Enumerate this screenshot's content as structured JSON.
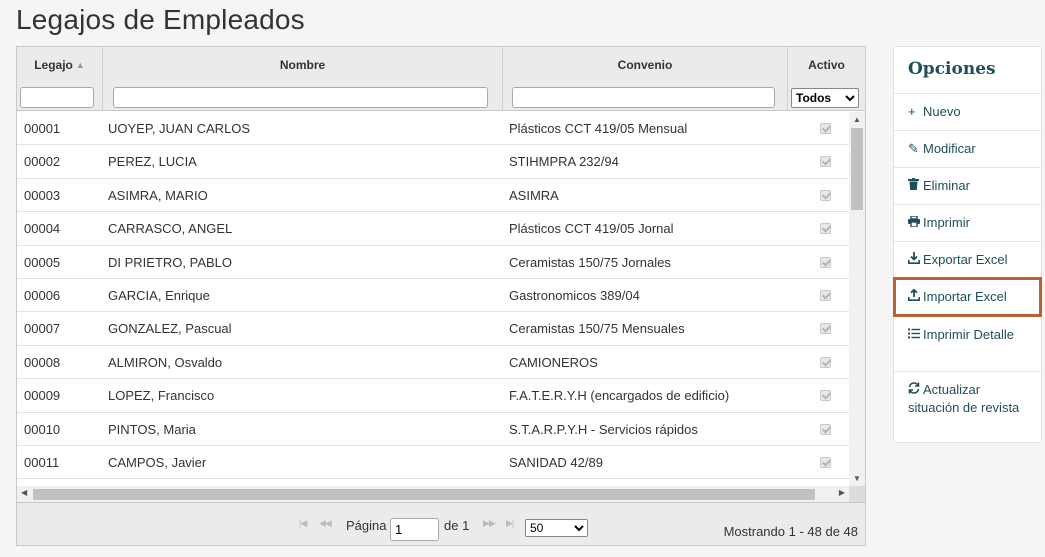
{
  "page": {
    "title": "Legajos de Empleados"
  },
  "grid": {
    "columns": [
      {
        "key": "legajo",
        "label": "Legajo"
      },
      {
        "key": "nombre",
        "label": "Nombre"
      },
      {
        "key": "convenio",
        "label": "Convenio"
      },
      {
        "key": "activo",
        "label": "Activo"
      }
    ],
    "activo_filter": {
      "selected": "Todos",
      "options": [
        "Todos"
      ]
    },
    "rows": [
      {
        "legajo": "00001",
        "nombre": "UOYEP, JUAN CARLOS",
        "convenio": "Plásticos CCT 419/05 Mensual"
      },
      {
        "legajo": "00002",
        "nombre": "PEREZ, LUCIA",
        "convenio": "STIHMPRA 232/94"
      },
      {
        "legajo": "00003",
        "nombre": "ASIMRA, MARIO",
        "convenio": "ASIMRA"
      },
      {
        "legajo": "00004",
        "nombre": "CARRASCO, ANGEL",
        "convenio": "Plásticos CCT 419/05 Jornal"
      },
      {
        "legajo": "00005",
        "nombre": "DI PRIETRO, PABLO",
        "convenio": "Ceramistas 150/75 Jornales"
      },
      {
        "legajo": "00006",
        "nombre": "GARCIA, Enrique",
        "convenio": "Gastronomicos 389/04"
      },
      {
        "legajo": "00007",
        "nombre": "GONZALEZ, Pascual",
        "convenio": "Ceramistas 150/75 Mensuales"
      },
      {
        "legajo": "00008",
        "nombre": "ALMIRON, Osvaldo",
        "convenio": "CAMIONEROS"
      },
      {
        "legajo": "00009",
        "nombre": "LOPEZ, Francisco",
        "convenio": "F.A.T.E.R.Y.H (encargados de edificio)"
      },
      {
        "legajo": "00010",
        "nombre": "PINTOS, Maria",
        "convenio": "S.T.A.R.P.Y.H - Servicios rápidos"
      },
      {
        "legajo": "00011",
        "nombre": "CAMPOS, Javier",
        "convenio": "SANIDAD 42/89"
      }
    ]
  },
  "pager": {
    "page_label": "Página",
    "page_value": "1",
    "of_label": "de 1",
    "page_size": "50",
    "summary": "Mostrando 1 - 48 de 48"
  },
  "options": {
    "title": "Opciones",
    "items": [
      {
        "label": "Nuevo",
        "icon": "plus-icon"
      },
      {
        "label": "Modificar",
        "icon": "pencil-icon"
      },
      {
        "label": "Eliminar",
        "icon": "trash-icon"
      },
      {
        "label": "Imprimir",
        "icon": "printer-icon"
      },
      {
        "label": "Exportar Excel",
        "icon": "download-icon"
      },
      {
        "label": "Importar Excel",
        "icon": "upload-icon"
      },
      {
        "label": "Imprimir Detalle",
        "icon": "list-icon"
      },
      {
        "label": "Actualizar situación de revista",
        "icon": "refresh-icon"
      }
    ]
  },
  "colors": {
    "accent": "#1f4f59",
    "highlight": "#b86036"
  }
}
